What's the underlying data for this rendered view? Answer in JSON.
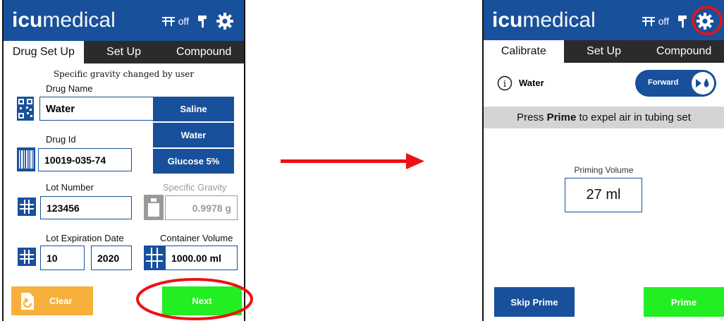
{
  "left_screen": {
    "brand": {
      "bold": "icu",
      "light": "medical"
    },
    "header_off": "off",
    "tabs": [
      "Drug Set Up",
      "Set Up",
      "Compound"
    ],
    "notice": "Specific gravity changed by user",
    "drug_name_label": "Drug Name",
    "drug_name_value": "Water",
    "drug_buttons": [
      "Saline",
      "Water",
      "Glucose 5%"
    ],
    "drug_id_label": "Drug Id",
    "drug_id_value": "10019-035-74",
    "lot_number_label": "Lot Number",
    "lot_number_value": "123456",
    "specific_gravity_label": "Specific Gravity",
    "specific_gravity_value": "0.9978 g",
    "lot_exp_label": "Lot Expiration Date",
    "lot_exp_month": "10",
    "lot_exp_year": "2020",
    "container_volume_label": "Container Volume",
    "container_volume_value": "1000.00 ml",
    "clear_label": "Clear",
    "next_label": "Next"
  },
  "right_screen": {
    "brand": {
      "bold": "icu",
      "light": "medical"
    },
    "header_off": "off",
    "tabs": [
      "Calibrate",
      "Set Up",
      "Compound"
    ],
    "drug_name": "Water",
    "direction_label": "Forward",
    "instruction_pre": "Press ",
    "instruction_bold": "Prime",
    "instruction_post": " to expel air in tubing set",
    "priming_volume_label": "Priming Volume",
    "priming_volume_value": "27 ml",
    "skip_prime_label": "Skip Prime",
    "prime_label": "Prime"
  },
  "colors": {
    "brand_blue": "#18509b",
    "tab_dark": "#2b2b2b",
    "clear_orange": "#f7b03c",
    "next_green": "#22ee22",
    "annotation_red": "#ee1111",
    "instruction_gray": "#d4d4d4"
  }
}
